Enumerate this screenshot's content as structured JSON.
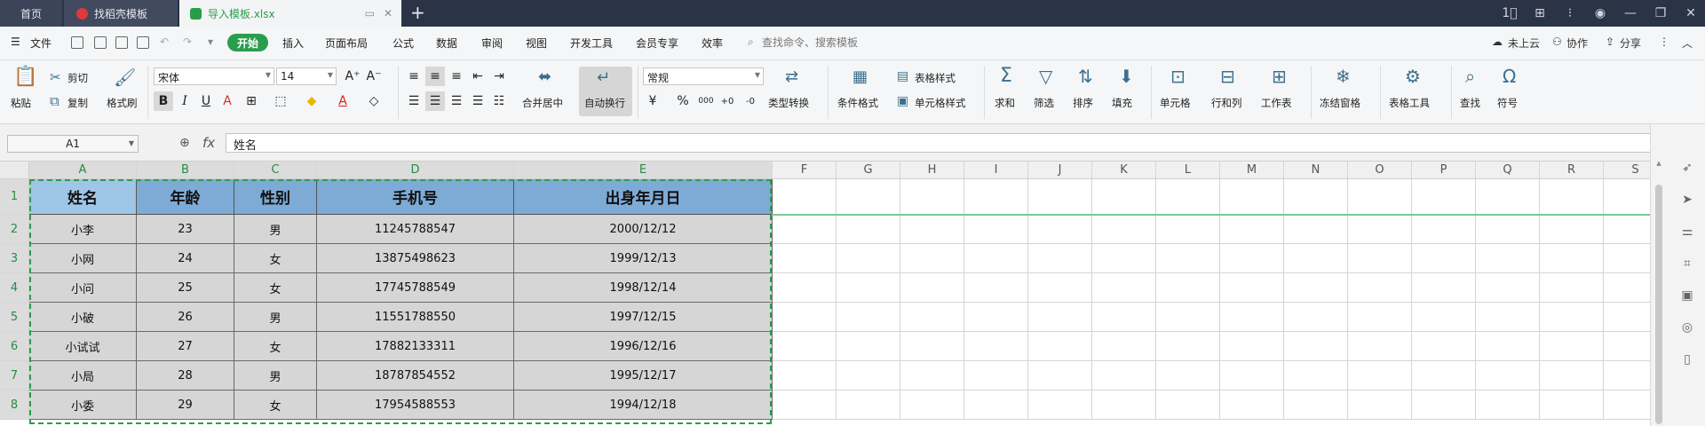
{
  "tabs": {
    "home": "首页",
    "template": "找稻壳模板",
    "file": "导入模板.xlsx",
    "add": "+"
  },
  "window_buttons": [
    "1⃞",
    "⊞",
    "⁝",
    "◉",
    "—",
    "❐",
    "✕"
  ],
  "menu": {
    "file": "文件",
    "start": "开始",
    "items": [
      "插入",
      "页面布局",
      "公式",
      "数据",
      "审阅",
      "视图",
      "开发工具",
      "会员专享",
      "效率"
    ],
    "search": "查找命令、搜索模板",
    "cloud": "未上云",
    "collab": "协作",
    "share": "分享"
  },
  "ribbon": {
    "paste": "粘贴",
    "cut": "剪切",
    "copy": "复制",
    "format_painter": "格式刷",
    "font_name": "宋体",
    "font_size": "14",
    "merge_center": "合并居中",
    "auto_wrap": "自动换行",
    "number_format": "常规",
    "currency": "¥",
    "percent": "%",
    "thousands": "000",
    "dec_add": "+0",
    "dec_sub": "-0",
    "type_convert": "类型转换",
    "conditional": "条件格式",
    "table_style": "表格样式",
    "cell_style": "单元格样式",
    "sum": "求和",
    "filter": "筛选",
    "sort": "排序",
    "fill": "填充",
    "cell": "单元格",
    "row_col": "行和列",
    "worksheet": "工作表",
    "freeze": "冻结窗格",
    "table_tools": "表格工具",
    "find": "查找",
    "symbol": "符号"
  },
  "formula_bar": {
    "cell_ref": "A1",
    "fx": "fx",
    "content": "姓名"
  },
  "sheet": {
    "columns": [
      "A",
      "B",
      "C",
      "D",
      "E",
      "F",
      "G",
      "H",
      "I",
      "J",
      "K",
      "L",
      "M",
      "N",
      "O",
      "P",
      "Q",
      "R",
      "S"
    ],
    "row_numbers": [
      "1",
      "2",
      "3",
      "4",
      "5",
      "6",
      "7",
      "8"
    ],
    "headers": [
      "姓名",
      "年龄",
      "性别",
      "手机号",
      "出身年月日"
    ],
    "rows": [
      [
        "小李",
        "23",
        "男",
        "11245788547",
        "2000/12/12"
      ],
      [
        "小网",
        "24",
        "女",
        "13875498623",
        "1999/12/13"
      ],
      [
        "小问",
        "25",
        "女",
        "17745788549",
        "1998/12/14"
      ],
      [
        "小破",
        "26",
        "男",
        "11551788550",
        "1997/12/15"
      ],
      [
        "小试试",
        "27",
        "女",
        "17882133311",
        "1996/12/16"
      ],
      [
        "小局",
        "28",
        "男",
        "18787854552",
        "1995/12/17"
      ],
      [
        "小委",
        "29",
        "女",
        "17954588553",
        "1994/12/18"
      ]
    ]
  },
  "colors": {
    "accent": "#2a9d4b",
    "header_fill": "#7eaad6",
    "header_fill_a1": "#9fc6e7",
    "data_fill": "#d6d6d6",
    "tabbar": "#2b3447"
  }
}
